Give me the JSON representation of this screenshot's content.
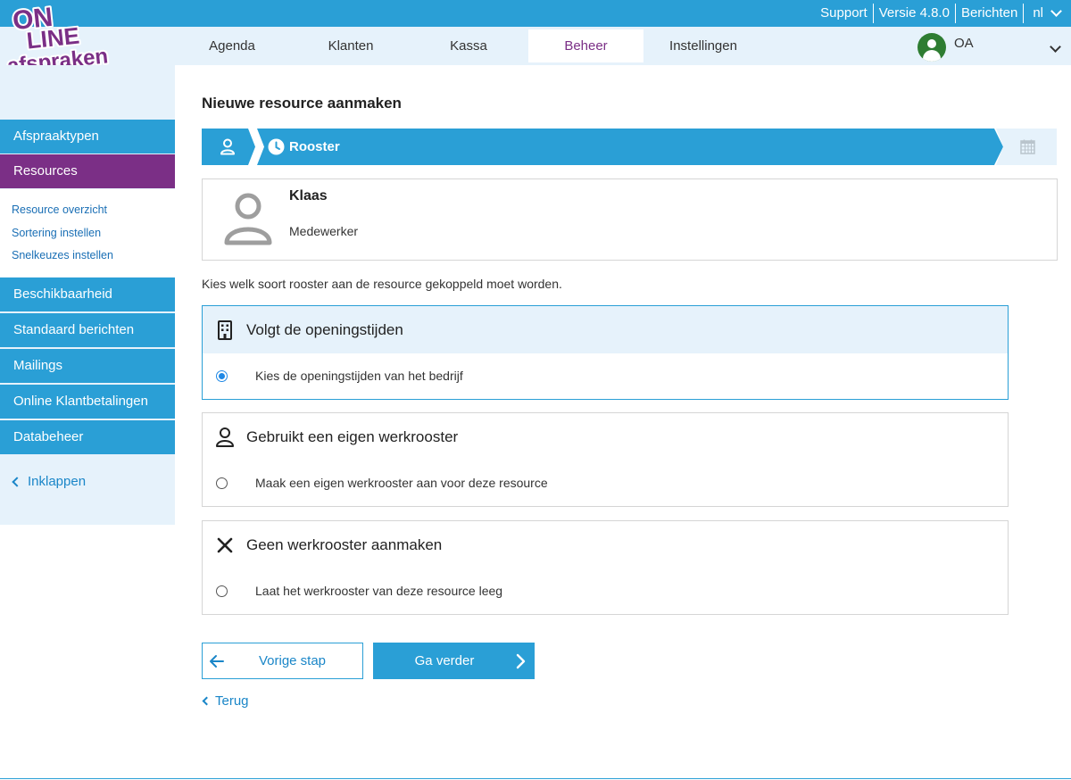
{
  "brand": {
    "logo_text": "ONLINE afspraken .NL",
    "purple": "#7b2f86",
    "blue": "#2a9fd6"
  },
  "topbar": {
    "support": "Support",
    "version": "Versie 4.8.0",
    "messages": "Berichten",
    "language": "nl"
  },
  "nav": {
    "tabs": [
      "Agenda",
      "Klanten",
      "Kassa",
      "Beheer",
      "Instellingen"
    ],
    "active_tab": "Beheer",
    "user_initials": "OA"
  },
  "sidebar": {
    "items_top": [
      "Afspraaktypen",
      "Resources"
    ],
    "active_item": "Resources",
    "sub_items": [
      "Resource overzicht",
      "Sortering instellen",
      "Snelkeuzes instellen"
    ],
    "items_bottom": [
      "Beschikbaarheid",
      "Standaard berichten",
      "Mailings",
      "Online Klantbetalingen",
      "Databeheer"
    ],
    "collapse": "Inklappen"
  },
  "main": {
    "title": "Nieuwe resource aanmaken",
    "wizard": {
      "step_label": "Rooster"
    },
    "resource": {
      "name": "Klaas",
      "role": "Medewerker"
    },
    "instruction": "Kies welk soort rooster aan de resource gekoppeld moet worden.",
    "options": [
      {
        "title": "Volgt de openingstijden",
        "description": "Kies de openingstijden van het bedrijf",
        "icon": "building-icon",
        "selected": true
      },
      {
        "title": "Gebruikt een eigen werkrooster",
        "description": "Maak een eigen werkrooster aan voor deze resource",
        "icon": "person-icon",
        "selected": false
      },
      {
        "title": "Geen werkrooster aanmaken",
        "description": "Laat het werkrooster van deze resource leeg",
        "icon": "close-icon",
        "selected": false
      }
    ],
    "buttons": {
      "previous": "Vorige stap",
      "next": "Ga verder"
    },
    "back": "Terug"
  }
}
